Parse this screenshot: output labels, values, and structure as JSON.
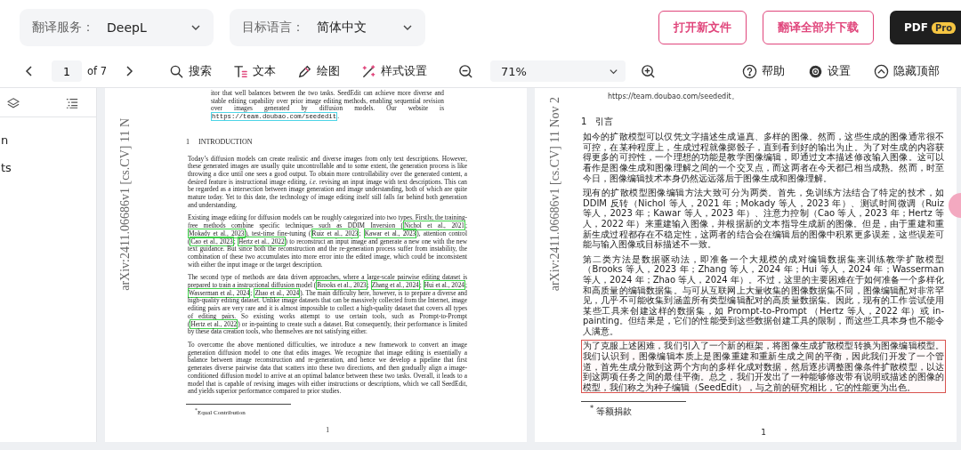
{
  "top_bar": {
    "translation_service": {
      "label": "翻译服务：",
      "value": "DeepL"
    },
    "target_language": {
      "label": "目标语言：",
      "value": "简体中文"
    },
    "buttons": [
      {
        "label": "打开新文件",
        "kind": "outline"
      },
      {
        "label": "翻译全部并下载",
        "kind": "outline"
      },
      {
        "label": "PDF",
        "badge": "Pro",
        "kind": "dark"
      }
    ]
  },
  "toolbar": {
    "page": "1",
    "page_count": "of 7",
    "tools": [
      {
        "label": "搜索",
        "kind": "search"
      },
      {
        "label": "文本",
        "kind": "text"
      },
      {
        "label": "绘图",
        "kind": "draw"
      },
      {
        "label": "样式设置",
        "kind": "style"
      }
    ],
    "zoom": "71%",
    "right_tools": [
      {
        "label": "帮助",
        "kind": "help"
      },
      {
        "label": "设置",
        "kind": "settings"
      },
      {
        "label": "隐藏顶部",
        "kind": "hide"
      }
    ]
  },
  "sidebar": {
    "items": [
      "n",
      "ts"
    ]
  },
  "pages": [
    {
      "kind": "original",
      "stamp": "arXiv:2411.06686v1 [cs.CV] 11 N",
      "lead": [
        {
          "kind": "text",
          "text": "itor that well balances between the two tasks. SeedEdit can achieve more diverse and stable editing capability over prior image editing methods, enabling sequential revision over images generated by diffusion models. Our website is "
        },
        {
          "kind": "url",
          "text": "https://team.doubao.com/seededit"
        },
        {
          "kind": "text",
          "text": "."
        }
      ],
      "heading": {
        "number": "1",
        "title": "INTRODUCTION"
      },
      "paragraphs": [
        {
          "highlighted": false,
          "segments": [
            {
              "kind": "text",
              "text": "Today’s diffusion models can create realistic and diverse images from only text descriptions. However, these generated images are usually quite uncontrollable and to some extent, the generation process is like throwing a dice until one sees a good output. To obtain more controllability over the generated content, a desired feature is instructional image editing, *i.e.* revising an input image with text descriptions. This can be regarded as a intersection between image generation and image understanding, both of which are quite mature today. Yet to this date, the technology of image editing itself still falls far behind both generation and understanding."
            }
          ]
        },
        {
          "highlighted": false,
          "segments": [
            {
              "kind": "text",
              "text": "Existing image editing for diffusion models can be roughly categorized into two types. Firstly, the training-free methods combine specific techniques such as DDIM Inversion ("
            },
            {
              "kind": "cite",
              "text": "Nichol et al., 2021"
            },
            {
              "kind": "text",
              "text": "; "
            },
            {
              "kind": "cite",
              "text": "Mokady et al., 2023"
            },
            {
              "kind": "text",
              "text": "), test-time fine-tuning ("
            },
            {
              "kind": "cite",
              "text": "Ruiz et al., 2023"
            },
            {
              "kind": "text",
              "text": "; "
            },
            {
              "kind": "cite",
              "text": "Kawar et al., 2023"
            },
            {
              "kind": "text",
              "text": "), attention control ("
            },
            {
              "kind": "cite",
              "text": "Cao et al., 2023"
            },
            {
              "kind": "text",
              "text": "; "
            },
            {
              "kind": "cite",
              "text": "Hertz et al., 2022"
            },
            {
              "kind": "text",
              "text": ") to reconstruct an input image and generate a new one with the new text guidance. But since both the reconstruction and the re-generation process suffer from instability, the combination of these two accumulates into more error into the edited image, which could be inconsistent with either the input image or the target description."
            }
          ]
        },
        {
          "highlighted": false,
          "segments": [
            {
              "kind": "text",
              "text": "The second type of methods are data driven approaches, where a large-scale pairwise editing dataset is prepared to train a instructional diffusion model ("
            },
            {
              "kind": "cite",
              "text": "Brooks et al., 2023"
            },
            {
              "kind": "text",
              "text": "; "
            },
            {
              "kind": "cite",
              "text": "Zhang et al., 2024"
            },
            {
              "kind": "text",
              "text": "; "
            },
            {
              "kind": "cite",
              "text": "Hui et al., 2024"
            },
            {
              "kind": "text",
              "text": "; "
            },
            {
              "kind": "cite",
              "text": "Wasserman et al., 2024"
            },
            {
              "kind": "text",
              "text": "; "
            },
            {
              "kind": "cite",
              "text": "Zhao et al., 2024"
            },
            {
              "kind": "text",
              "text": "). The main difficulty here, however, is to prepare a diverse and high-quality editing dataset. Unlike image datasets that can be massively collected from the Internet, image editing pairs are very rare and it is almost impossible to collect a high-quality dataset that covers all types of editing pairs. So existing works attempt to use certain tools, such as Prompt-to-Prompt ("
            },
            {
              "kind": "cite",
              "text": "Hertz et al., 2022"
            },
            {
              "kind": "text",
              "text": ") or in-painting to create such a dataset. But consequently, their performance is limited by these data creation tools, who themselves are not satisfying either."
            }
          ]
        },
        {
          "highlighted": false,
          "segments": [
            {
              "kind": "text",
              "text": "To overcome the above mentioned difficulties, we introduce a new framework to convert an image generation diffusion model to one that edits images. We recognize that image editing is essentially a balance between image reconstruction and re-generation, and hence we develop a pipeline that first generates diverse pairwise data that scatters into these two directions, and then gradually align a image-conditioned diffusion model to arrive at an optimal balance between these two tasks. Overall, it leads to a model that is capable of revising images with either instructions or descriptions, which we call SeedEdit, and yields superior performance compared to prior studies."
            }
          ]
        }
      ],
      "footnote": "$^{*}$Equal Contribution",
      "page_number": "1"
    },
    {
      "kind": "translation",
      "stamp": "arXiv:2411.06686v1 [cs.CV] 11 Nov 2",
      "lead": [
        {
          "kind": "text",
          "text": "https://team.doubao.com/seededit。"
        }
      ],
      "heading": {
        "number": "1",
        "title": "引言"
      },
      "paragraphs": [
        {
          "highlighted": false,
          "segments": [
            {
              "kind": "text",
              "text": "如今的扩散模型可以仅凭文字描述生成逼真、多样的图像。然而，这些生成的图像通常很不可控，在某种程度上，生成过程就像掷骰子，直到看到好的输出为止。为了对生成的内容获得更多的可控性，一个理想的功能是教学图像编辑，即通过文本描述修改输入图像。这可以看作是图像生成和图像理解之间的一个交叉点，而这两者在今天都已相当成熟。然而，时至今日，图像编辑技术本身仍然远远落后于图像生成和图像理解。"
            }
          ]
        },
        {
          "highlighted": false,
          "segments": [
            {
              "kind": "text",
              "text": "现有的扩散模型图像编辑方法大致可分为两类。首先，免训练方法结合了特定的技术，如 DDIM 反转（Nichol 等人，2021 年；Mokady 等人，2023 年）、测试时间微调（Ruiz 等人，2023 年；Kawar 等人，2023 年）、注意力控制（Cao 等人，2023 年；Hertz 等人，2022 年）来重建输入图像，并根据新的文本指导生成新的图像。但是，由于重建和重新生成过程都存在不稳定性，这两者的结合会在编辑后的图像中积累更多误差，这些误差可能与输入图像或目标描述不一致。"
            }
          ]
        },
        {
          "highlighted": false,
          "segments": [
            {
              "kind": "text",
              "text": "第二类方法是数据驱动法，即准备一个大规模的成对编辑数据集来训练教学扩散模型（Brooks 等人，2023 年；Zhang 等人，2024 年；Hui 等人，2024 年；Wasserman 等人，2024 年；Zhao 等人，2024 年）。不过，这里的主要困难在于如何准备一个多样化和高质量的编辑数据集。与可从互联网上大量收集的图像数据集不同，图像编辑配对非常罕见，几乎不可能收集到涵盖所有类型编辑配对的高质量数据集。因此，现有的工作尝试使用某些工具来创建这样的数据集，如 Prompt-to-Prompt （Hertz 等人，2022 年）或 in-painting。但结果是，它们的性能受到这些数据创建工具的限制，而这些工具本身也不能令人满意。"
            }
          ]
        },
        {
          "highlighted": true,
          "segments": [
            {
              "kind": "text",
              "text": "为了克服上述困难，我们引入了一个新的框架，将图像生成扩散模型转换为图像编辑模型。我们认识到，图像编辑本质上是图像重建和重新生成之间的平衡，因此我们开发了一个管道，首先生成分散到这两个方向的多样化成对数据，然后逐步调整图像条件扩散模型，以达到这两项任务之间的最佳平衡。总之，我们开发出了一种能够修改带有说明或描述的图像的模型，我们称之为种子编辑（SeedEdit），与之前的研究相比，它的性能更为出色。"
            }
          ]
        }
      ],
      "footnote": "$^{*}$ 等额捐款",
      "page_number": "1"
    }
  ]
}
